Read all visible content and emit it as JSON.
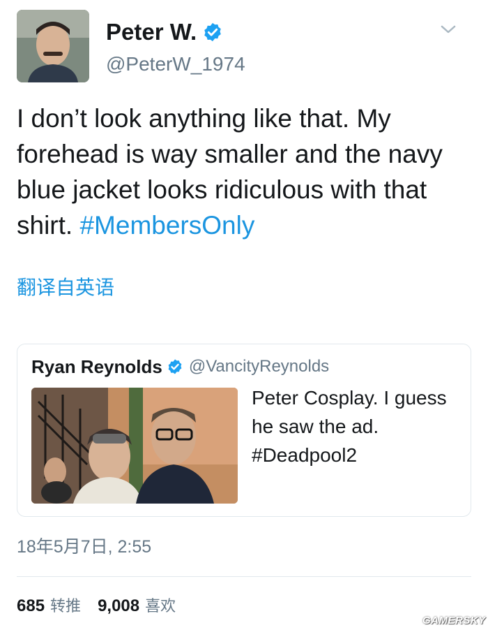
{
  "tweet": {
    "author": {
      "display_name": "Peter W.",
      "handle": "@PeterW_1974",
      "verified": true
    },
    "text_main": "I don’t look anything like that. My forehead is way smaller and the navy blue jacket looks ridiculous with that shirt.",
    "hashtag": "#MembersOnly",
    "translate_label": "翻译自英语",
    "timestamp": "18年5月7日, 2:55",
    "stats": {
      "retweets_count": "685",
      "retweets_label": "转推",
      "likes_count": "9,008",
      "likes_label": "喜欢"
    }
  },
  "quoted_tweet": {
    "display_name": "Ryan Reynolds",
    "handle": "@VancityReynolds",
    "verified": true,
    "text": "Peter Cosplay. I guess he saw the ad. #Deadpool2"
  },
  "icons": {
    "verified": "verified-badge-icon",
    "menu": "chevron-down-icon"
  },
  "colors": {
    "link": "#1b95e0",
    "secondary_text": "#657786",
    "border": "#e1e8ed"
  },
  "watermark": "GAMERSKY"
}
